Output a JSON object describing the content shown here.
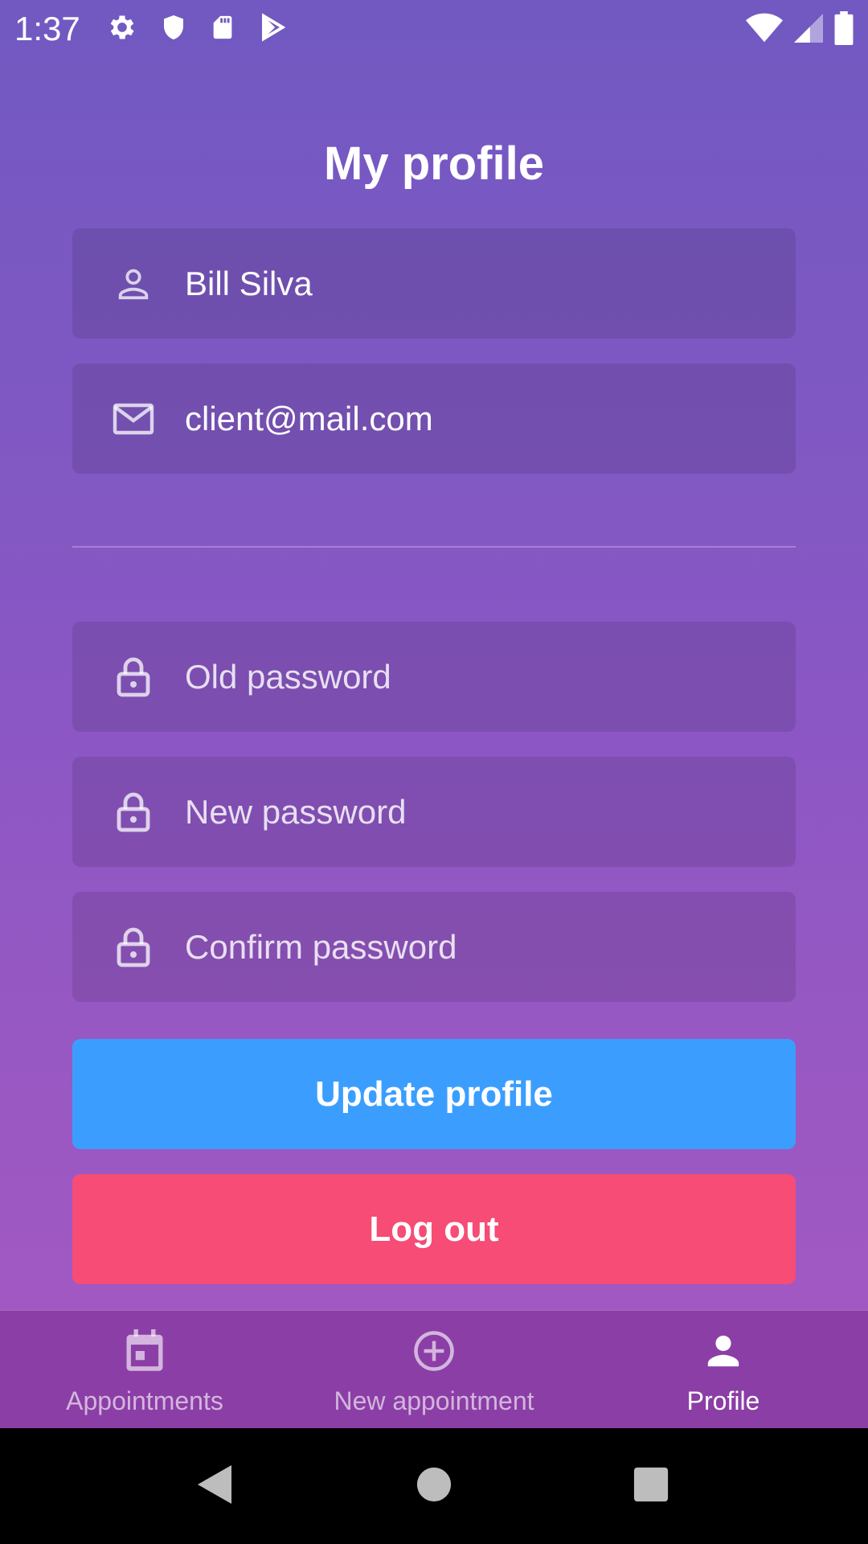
{
  "status_bar": {
    "time": "1:37",
    "left_icons": [
      "settings-icon",
      "shield-icon",
      "sd-card-icon",
      "play-store-icon"
    ],
    "right_icons": [
      "wifi-icon",
      "signal-icon",
      "battery-icon"
    ]
  },
  "page": {
    "title": "My profile"
  },
  "form": {
    "name": {
      "value": "Bill Silva",
      "icon": "user-icon"
    },
    "email": {
      "value": "client@mail.com",
      "icon": "mail-icon"
    },
    "old_password": {
      "placeholder": "Old password",
      "icon": "lock-icon"
    },
    "new_password": {
      "placeholder": "New password",
      "icon": "lock-icon"
    },
    "confirm_password": {
      "placeholder": "Confirm password",
      "icon": "lock-icon"
    }
  },
  "buttons": {
    "update_label": "Update profile",
    "logout_label": "Log out"
  },
  "tabs": [
    {
      "label": "Appointments",
      "icon": "calendar-icon",
      "active": false
    },
    {
      "label": "New appointment",
      "icon": "add-circle-icon",
      "active": false
    },
    {
      "label": "Profile",
      "icon": "person-icon",
      "active": true
    }
  ],
  "colors": {
    "gradient_top": "#7159c1",
    "gradient_bottom": "#ab59c1",
    "update_button": "#3b9eff",
    "logout_button": "#f64c75",
    "tab_bar": "#8b3ea6"
  }
}
